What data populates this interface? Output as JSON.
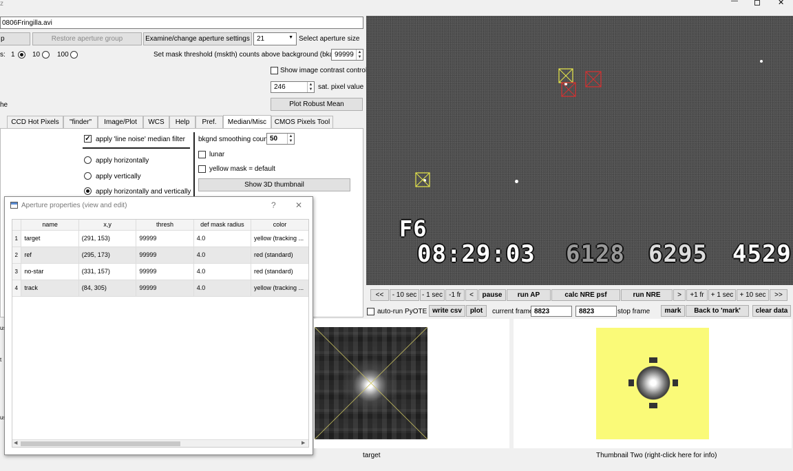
{
  "window": {
    "title_fragment": "z",
    "file_path": "0806Fringilla.avi"
  },
  "top_controls": {
    "left_button_fragment": "p",
    "restore_aperture_group": "Restore aperture group",
    "examine_aperture_settings": "Examine/change aperture settings",
    "aperture_size_value": "21",
    "select_aperture_size": "Select aperture size",
    "scale_prefix": "s:",
    "scale_options": [
      "1",
      "10",
      "100"
    ],
    "scale_selected": "1",
    "mask_threshold_label": "Set mask threshold (mskth) counts above background (bkavg)",
    "mask_threshold_value": "99999",
    "show_contrast_label": "Show image contrast control",
    "sat_value": "246",
    "sat_label": "sat. pixel value",
    "plot_robust_mean": "Plot Robust Mean",
    "left_fragment": "he"
  },
  "tabs": [
    "CCD Hot Pixels",
    "\"finder\"",
    "Image/Plot",
    "WCS",
    "Help",
    "Pref.",
    "Median/Misc",
    "CMOS Pixels Tool"
  ],
  "active_tab": "Median/Misc",
  "median_panel": {
    "apply_median_label": "apply 'line noise' median filter",
    "apply_horizontally": "apply horizontally",
    "apply_vertically": "apply vertically",
    "apply_both": "apply horizontally and vertically",
    "bkgnd_label": "bkgnd smoothing count",
    "bkgnd_value": "50",
    "lunar": "lunar",
    "yellow_mask": "yellow mask = default",
    "show_3d": "Show 3D thumbnail"
  },
  "dialog": {
    "title": "Aperture properties (view and edit)",
    "help_glyph": "?",
    "close_glyph": "✕",
    "columns": [
      "name",
      "x,y",
      "thresh",
      "def mask radius",
      "color"
    ],
    "rows": [
      {
        "num": "1",
        "name": "target",
        "xy": "(291, 153)",
        "thresh": "99999",
        "radius": "4.0",
        "color": "yellow (tracking ..."
      },
      {
        "num": "2",
        "name": "ref",
        "xy": "(295, 173)",
        "thresh": "99999",
        "radius": "4.0",
        "color": "red (standard)"
      },
      {
        "num": "3",
        "name": "no-star",
        "xy": "(331, 157)",
        "thresh": "99999",
        "radius": "4.0",
        "color": "red (standard)"
      },
      {
        "num": "4",
        "name": "track",
        "xy": "(84, 305)",
        "thresh": "99999",
        "radius": "4.0",
        "color": "yellow (tracking ..."
      }
    ]
  },
  "video": {
    "field_label": "F6",
    "timestamp": "08:29:03",
    "num_a": "6128",
    "num_b": "6295",
    "num_c": "4529"
  },
  "playback": {
    "buttons": [
      "<<",
      "- 10 sec",
      "- 1 sec",
      "-1 fr",
      "<",
      "pause",
      "run AP",
      "calc NRE psf",
      "run NRE",
      ">",
      "+1 fr",
      "+ 1 sec",
      "+ 10 sec",
      ">>"
    ],
    "auto_run_pyote": "auto-run PyOTE",
    "write_csv": "write csv",
    "plot": "plot",
    "current_frame_label": "current frame",
    "current_frame_value": "8823",
    "stop_frame_value": "8823",
    "stop_frame_label": "stop frame",
    "mark": "mark",
    "back_to_mark": "Back to 'mark'",
    "clear_data": "clear data"
  },
  "thumbnails": {
    "one_label": "target",
    "two_label": "Thumbnail Two (right-click here for info)"
  },
  "left_edge_fragments": [
    "us",
    "t",
    "us"
  ],
  "colors": {
    "yellow_aperture": "#e8e84a",
    "red_aperture": "#d83030",
    "thumb_two_bg": "#fafa78"
  }
}
